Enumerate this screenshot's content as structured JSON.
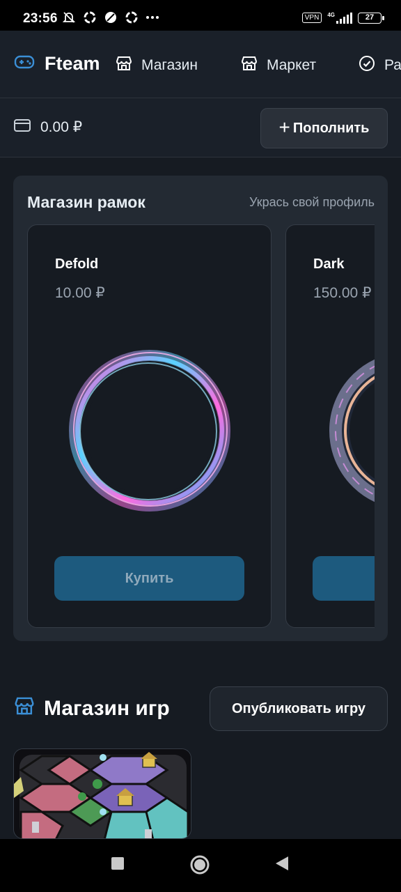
{
  "status": {
    "time": "23:56",
    "vpn": "VPN",
    "network": "4G",
    "battery": "27"
  },
  "nav": {
    "brand": "Fteam",
    "items": [
      {
        "label": "Магазин",
        "icon": "store-icon"
      },
      {
        "label": "Маркет",
        "icon": "store-icon"
      },
      {
        "label": "Ра",
        "icon": "badge-check-icon"
      }
    ]
  },
  "balance": {
    "amount": "0.00 ₽",
    "topup_label": "Пополнить"
  },
  "frames": {
    "title": "Магазин рамок",
    "subtitle": "Укрась свой профиль",
    "items": [
      {
        "name": "Defold",
        "price": "10.00 ₽",
        "buy_label": "Купить"
      },
      {
        "name": "Dark",
        "price": "150.00 ₽",
        "buy_label": ""
      }
    ]
  },
  "games": {
    "title": "Магазин игр",
    "publish_label": "Опубликовать игру"
  },
  "colors": {
    "accent": "#3b8fd6",
    "button": "#1d5a7e",
    "background": "#161b22",
    "panel": "#232a33"
  }
}
